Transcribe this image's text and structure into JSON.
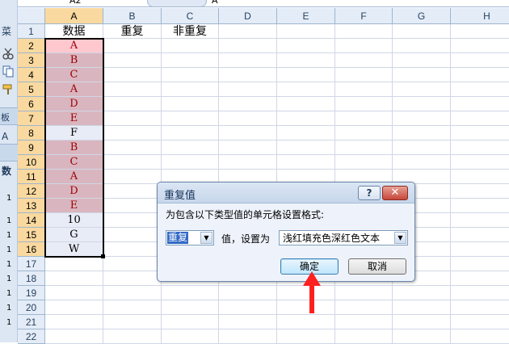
{
  "name_box": "A2",
  "formula": "A",
  "left_strip": {
    "items": [
      "菜",
      "板",
      "A",
      "数"
    ],
    "row_fragments": [
      "1",
      "1",
      "1",
      "1",
      "1",
      "1",
      "1",
      "1",
      "1"
    ]
  },
  "columns": [
    "A",
    "B",
    "C",
    "D",
    "E",
    "F",
    "G",
    "H"
  ],
  "rows": [
    "1",
    "2",
    "3",
    "4",
    "5",
    "6",
    "7",
    "8",
    "9",
    "10",
    "11",
    "12",
    "13",
    "14",
    "15",
    "16",
    "17",
    "18",
    "19",
    "20",
    "21",
    "22"
  ],
  "cells": {
    "header_a": "数据",
    "header_b": "重复",
    "header_c": "非重复",
    "col_a": [
      "A",
      "B",
      "C",
      "A",
      "D",
      "E",
      "F",
      "B",
      "C",
      "A",
      "D",
      "E",
      "10",
      "G",
      "W"
    ]
  },
  "dialog": {
    "title": "重复值",
    "help": "?",
    "close": "✕",
    "description": "为包含以下类型值的单元格设置格式:",
    "type_value": "重复",
    "set_label": "值，设置为",
    "format_value": "浅红填充色深红色文本",
    "ok": "确定",
    "cancel": "取消"
  },
  "colors": {
    "duplicate_fill": "#d9b6bf",
    "duplicate_text": "#9c0006",
    "annotation_arrow": "#ff2020"
  }
}
